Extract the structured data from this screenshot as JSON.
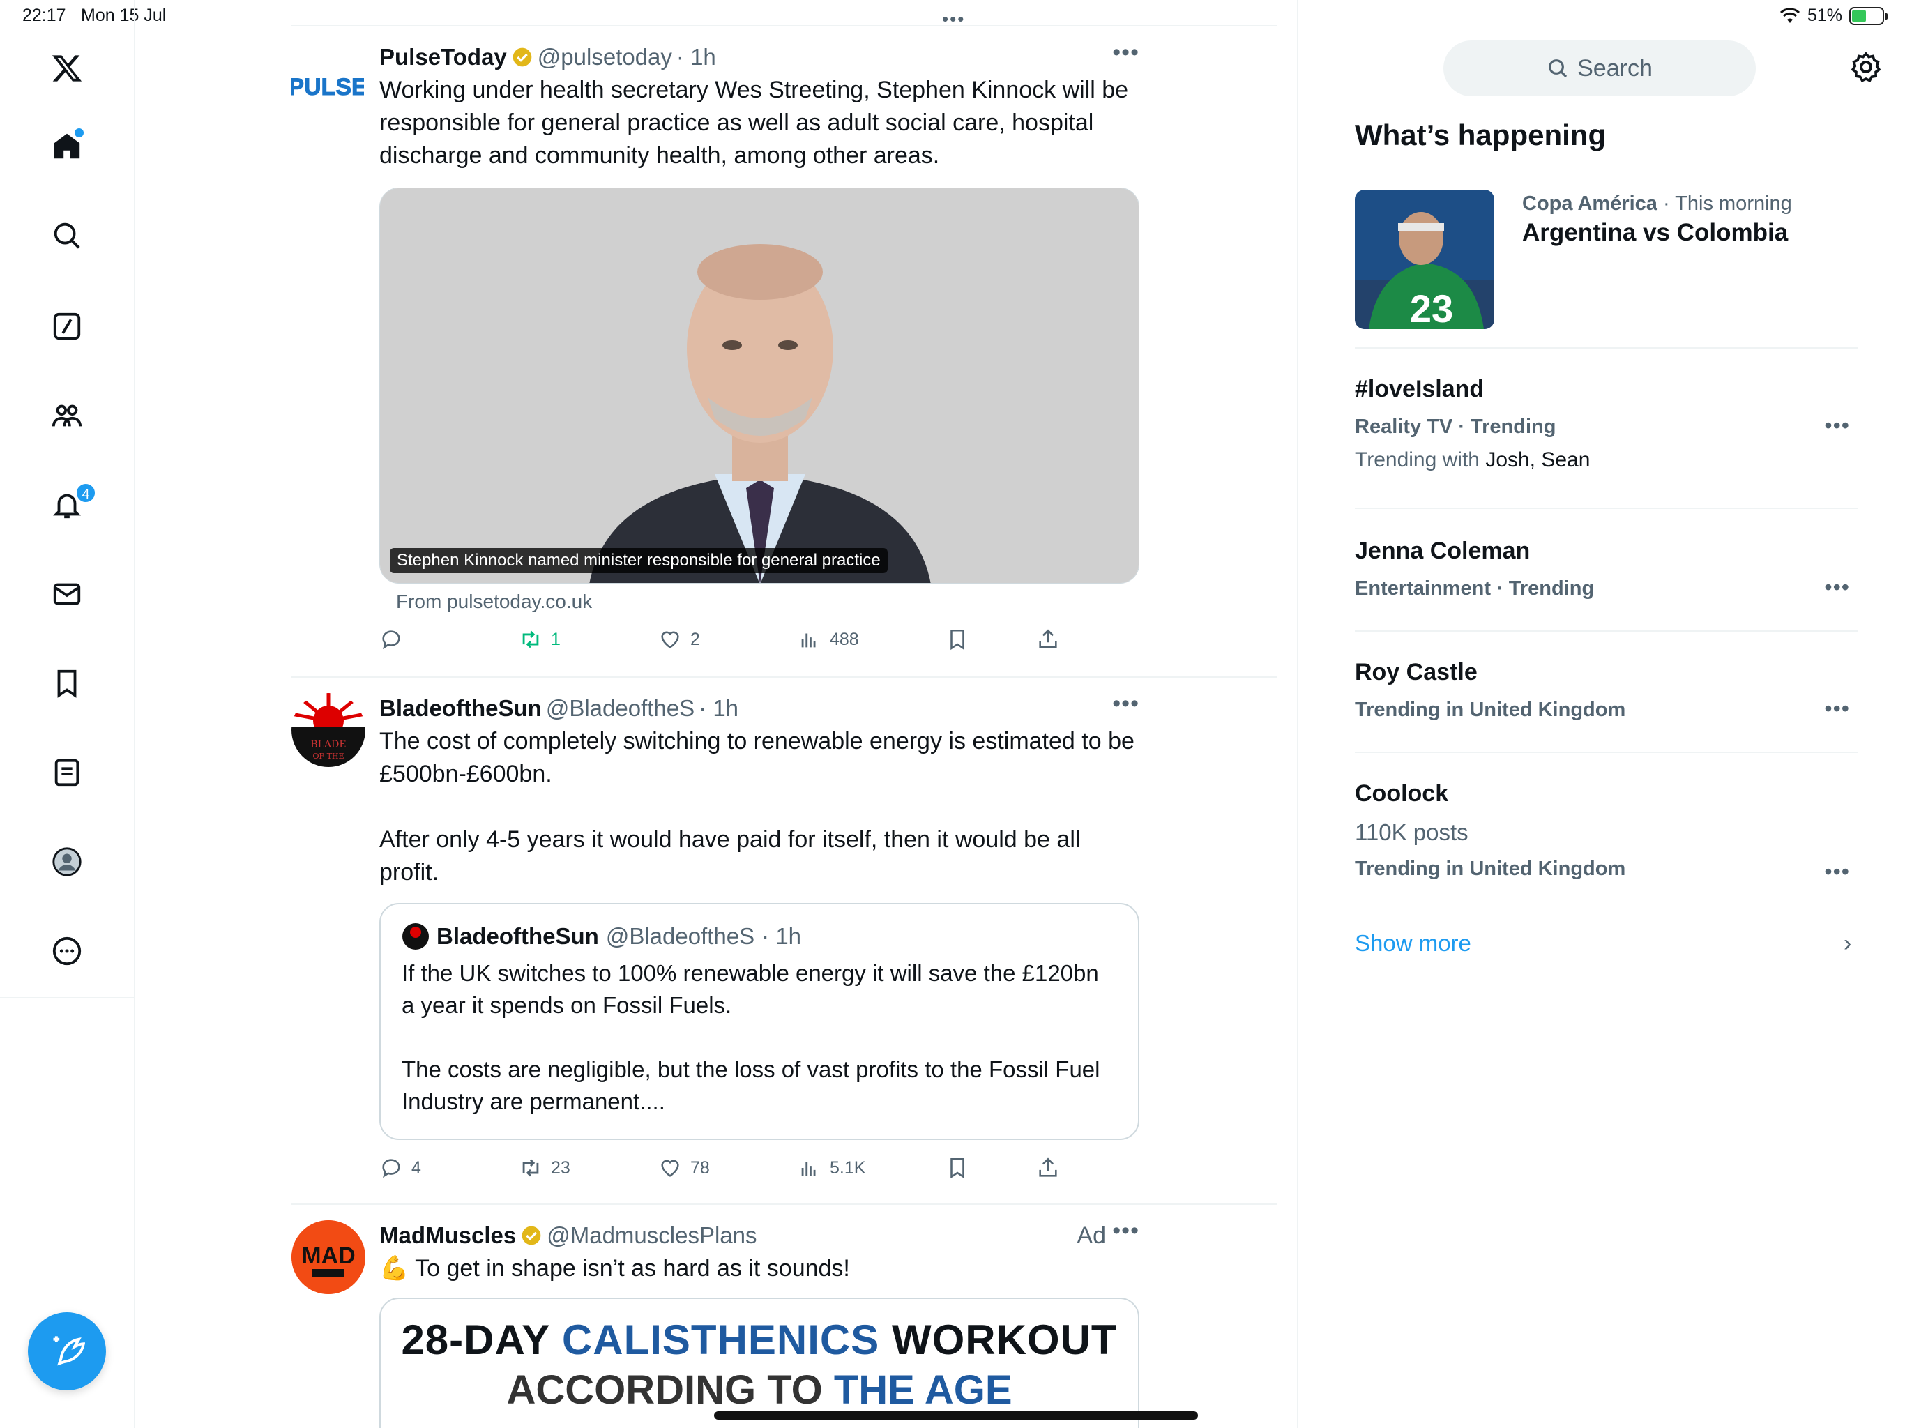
{
  "status_bar": {
    "time": "22:17",
    "date": "Mon 15 Jul",
    "battery": "51%",
    "battery_level": 0.51
  },
  "nav": {
    "notifications_badge": "4",
    "items": [
      "x-logo",
      "home",
      "explore",
      "grok",
      "communities",
      "notifications",
      "messages",
      "bookmarks",
      "lists",
      "profile",
      "more"
    ]
  },
  "tweets": [
    {
      "name": "PulseToday",
      "handle": "@pulsetoday",
      "time": "· 1h",
      "avatar_text": "PULSE",
      "text": "Working under health secretary Wes Streeting, Stephen Kinnock will be responsible for general practice as well as adult social care, hospital discharge and community health, among other areas.",
      "card_caption": "Stephen Kinnock named minister responsible for general practice",
      "card_from": "From pulsetoday.co.uk",
      "replies": "",
      "reposts": "1",
      "likes": "2",
      "views": "488"
    },
    {
      "name": "BladeoftheSun",
      "handle": "@BladeoftheS",
      "time": "· 1h",
      "text": "The cost of completely switching to renewable energy is estimated to be £500bn-£600bn.\n\nAfter only 4-5 years it would have paid for itself, then it would be all profit.",
      "quote": {
        "name": "BladeoftheSun",
        "handle": "@BladeoftheS",
        "time": "· 1h",
        "text": "If the UK switches to 100% renewable energy it will save the £120bn a year it spends on Fossil Fuels.\n\nThe costs are negligible, but the loss of vast profits to the Fossil Fuel Industry are permanent...."
      },
      "replies": "4",
      "reposts": "23",
      "likes": "78",
      "views": "5.1K"
    },
    {
      "name": "MadMuscles",
      "handle": "@MadmusclesPlans",
      "ad_label": "Ad",
      "text": "💪 To get in shape isn’t as hard as it sounds!",
      "promo": {
        "l1_a": "28-DAY ",
        "l1_b": "CALISTHENICS",
        "l1_c": " WORKOUT",
        "l2_a": "ACCORDING TO ",
        "l2_b": "THE AGE"
      }
    }
  ],
  "sidebar": {
    "search_placeholder": "Search",
    "heading": "What’s happening",
    "trends": [
      {
        "category": "Copa América",
        "meta": " · This morning",
        "topic": "Argentina vs Colombia"
      },
      {
        "topic": "#loveIsland",
        "category": "Reality TV · Trending",
        "with_label": "Trending with ",
        "with_names": "Josh, Sean"
      },
      {
        "topic": "Jenna Coleman",
        "category": "Entertainment · Trending"
      },
      {
        "topic": "Roy Castle",
        "category": "Trending in United Kingdom"
      },
      {
        "topic": "Coolock",
        "posts": "110K posts",
        "category": "Trending in United Kingdom"
      }
    ],
    "show_more": "Show more"
  },
  "colors": {
    "accent": "#1d9bf0",
    "text": "#0f1419",
    "muted": "#536471",
    "repost_active": "#00ba7c"
  }
}
